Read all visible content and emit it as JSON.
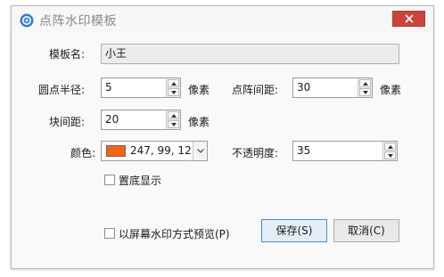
{
  "window": {
    "title": "点阵水印模板"
  },
  "form": {
    "template_name_label": "模板名:",
    "template_name_value": "小王",
    "dot_radius_label": "圆点半径:",
    "dot_radius_value": "5",
    "dot_spacing_label": "点阵间距:",
    "dot_spacing_value": "30",
    "block_spacing_label": "块间距:",
    "block_spacing_value": "20",
    "unit": "像素",
    "color_label": "颜色:",
    "color_value": "247, 99, 12",
    "color_swatch": "#f7630c",
    "opacity_label": "不透明度:",
    "opacity_value": "35",
    "bottom_layer_label": "置底显示",
    "bottom_layer_checked": false
  },
  "footer": {
    "preview_label": "以屏幕水印方式预览(P)",
    "preview_checked": false,
    "save_label": "保存(S)",
    "cancel_label": "取消(C)"
  },
  "colors": {
    "close_button": "#c9463d",
    "app_icon": "#2b7fd4",
    "primary_border": "#3c8ed5"
  },
  "icons": [
    "app-icon",
    "close-icon",
    "spin-up-icon",
    "spin-down-icon",
    "chevron-down-icon"
  ]
}
